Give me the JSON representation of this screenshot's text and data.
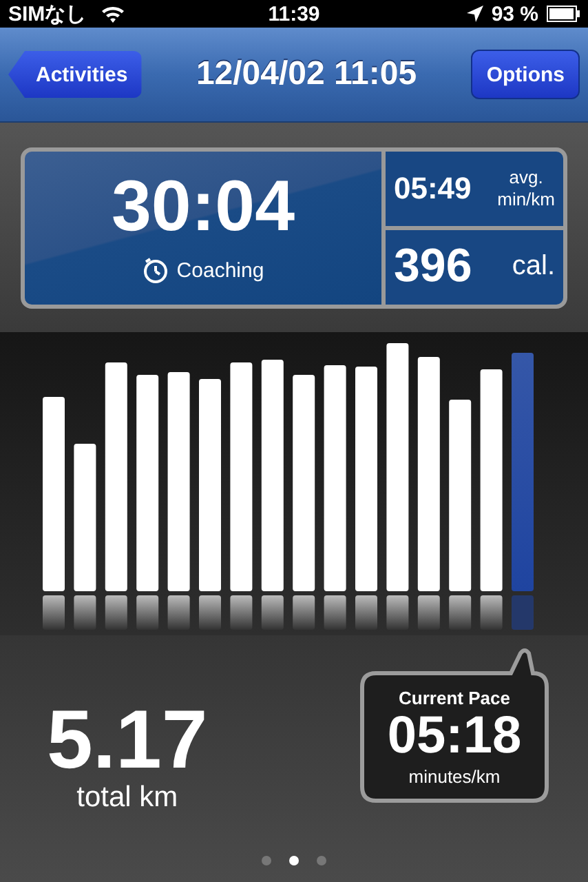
{
  "status_bar": {
    "carrier": "SIMなし",
    "time": "11:39",
    "battery": "93 %"
  },
  "nav": {
    "back_button": "Activities",
    "title": "12/04/02 11:05",
    "options_button": "Options"
  },
  "stats": {
    "duration": "30:04",
    "mode": "Coaching",
    "avg_pace": "05:49",
    "avg_label": "avg.",
    "avg_unit": "min/km",
    "calories": "396",
    "calories_unit": "cal."
  },
  "distance": {
    "value": "5.17",
    "unit": "total km"
  },
  "current_pace": {
    "title": "Current Pace",
    "value": "05:18",
    "unit": "minutes/km"
  },
  "page_dots": [
    {
      "selected": false
    },
    {
      "selected": true
    },
    {
      "selected": false
    }
  ]
}
